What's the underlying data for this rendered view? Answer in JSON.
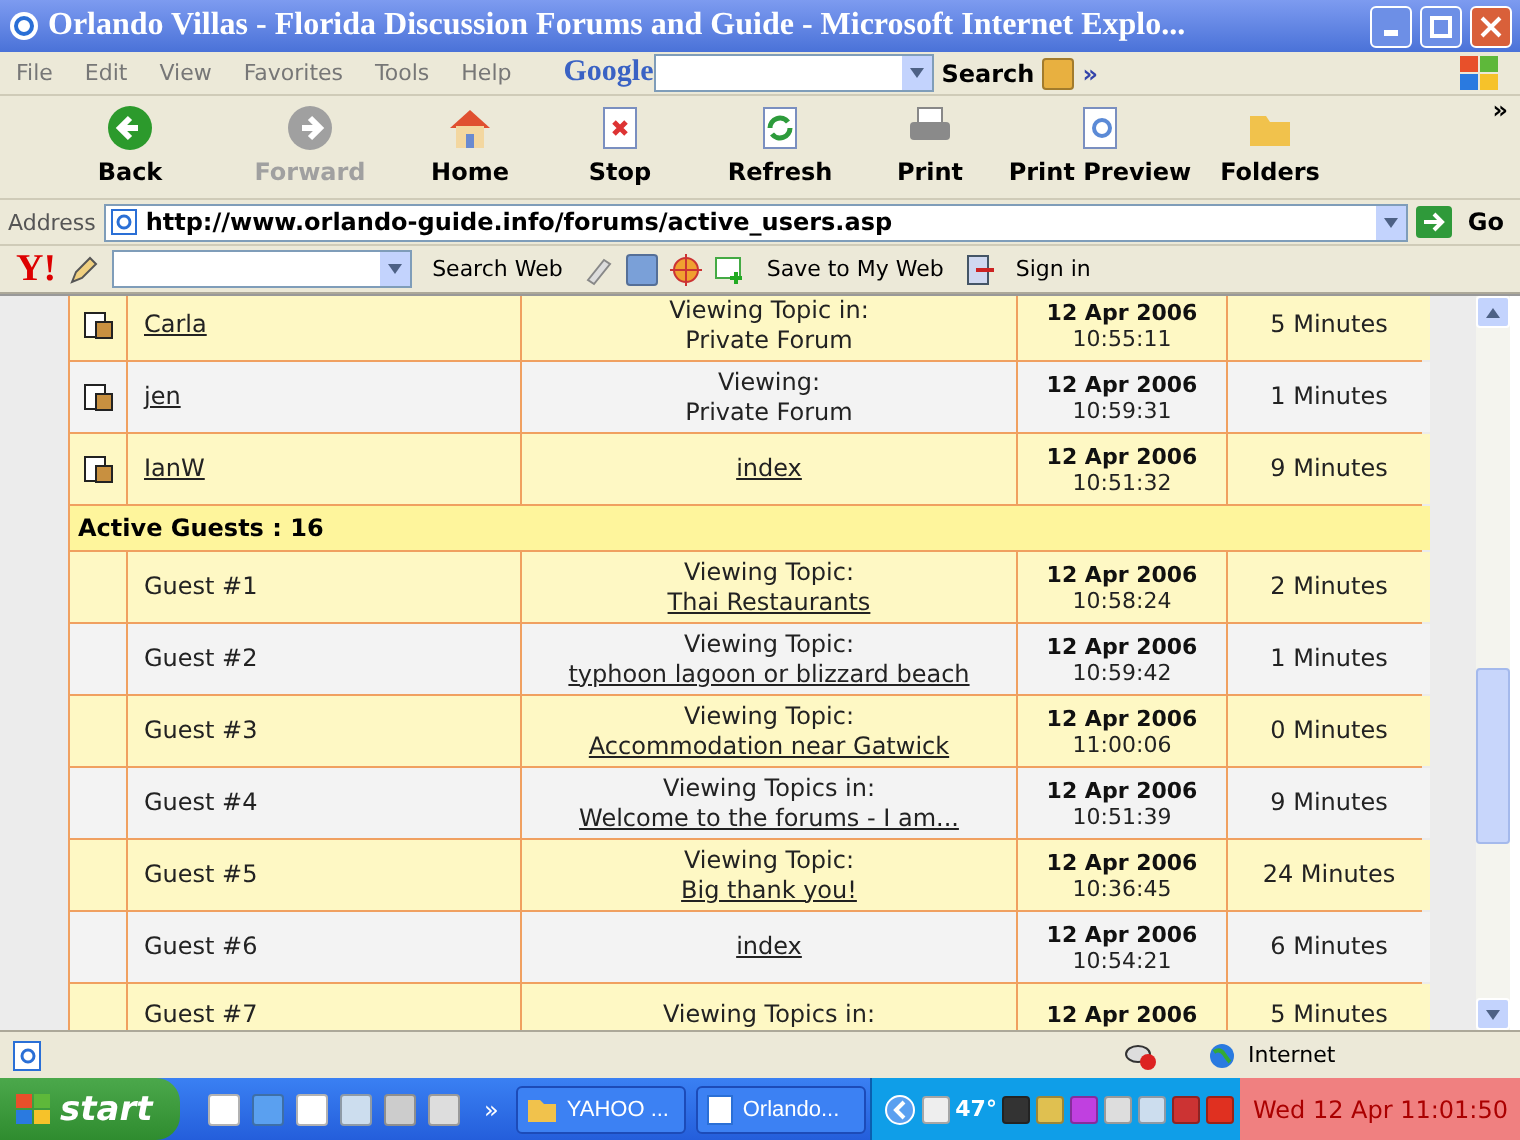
{
  "window": {
    "title": "Orlando Villas - Florida Discussion Forums and Guide - Microsoft Internet Explo..."
  },
  "menu": [
    "File",
    "Edit",
    "View",
    "Favorites",
    "Tools",
    "Help"
  ],
  "google": {
    "logo": "Google",
    "search": "Search",
    "more": "»"
  },
  "toolbar": [
    {
      "kind": "back",
      "label": "Back",
      "disabled": false
    },
    {
      "kind": "forward",
      "label": "Forward",
      "disabled": true
    },
    {
      "kind": "home",
      "label": "Home",
      "disabled": false
    },
    {
      "kind": "stop",
      "label": "Stop",
      "disabled": false
    },
    {
      "kind": "refresh",
      "label": "Refresh",
      "disabled": false
    },
    {
      "kind": "print",
      "label": "Print",
      "disabled": false
    },
    {
      "kind": "preview",
      "label": "Print Preview",
      "disabled": false
    },
    {
      "kind": "folders",
      "label": "Folders",
      "disabled": false
    }
  ],
  "toolbar_more": "»",
  "address": {
    "label": "Address",
    "url": "http://www.orlando-guide.info/forums/active_users.asp",
    "go": "Go"
  },
  "yahoo": {
    "logo": "Y!",
    "search": "Search Web",
    "save": "Save to My Web",
    "signin": "Sign in"
  },
  "rows": [
    {
      "kind": "member",
      "name": "Carla",
      "location": [
        {
          "text": "Viewing Topic in:",
          "linked": false
        },
        {
          "text": "Private Forum",
          "linked": false
        }
      ],
      "date": "12 Apr 2006",
      "time": "10:55:11",
      "duration": "5 Minutes"
    },
    {
      "kind": "member",
      "name": "jen",
      "location": [
        {
          "text": "Viewing:",
          "linked": false
        },
        {
          "text": "Private Forum",
          "linked": false
        }
      ],
      "date": "12 Apr 2006",
      "time": "10:59:31",
      "duration": "1 Minutes"
    },
    {
      "kind": "member",
      "name": "IanW",
      "location": [
        {
          "text": "index",
          "linked": true
        }
      ],
      "date": "12 Apr 2006",
      "time": "10:51:32",
      "duration": "9 Minutes"
    },
    {
      "kind": "header",
      "text": "Active Guests : 16"
    },
    {
      "kind": "guest",
      "name": "Guest #1",
      "location": [
        {
          "text": "Viewing Topic:",
          "linked": false
        },
        {
          "text": "Thai Restaurants",
          "linked": true
        }
      ],
      "date": "12 Apr 2006",
      "time": "10:58:24",
      "duration": "2 Minutes"
    },
    {
      "kind": "guest",
      "name": "Guest #2",
      "location": [
        {
          "text": "Viewing Topic:",
          "linked": false
        },
        {
          "text": "typhoon lagoon or blizzard beach",
          "linked": true
        }
      ],
      "date": "12 Apr 2006",
      "time": "10:59:42",
      "duration": "1 Minutes"
    },
    {
      "kind": "guest",
      "name": "Guest #3",
      "location": [
        {
          "text": "Viewing Topic:",
          "linked": false
        },
        {
          "text": "Accommodation near Gatwick",
          "linked": true
        }
      ],
      "date": "12 Apr 2006",
      "time": "11:00:06",
      "duration": "0 Minutes"
    },
    {
      "kind": "guest",
      "name": "Guest #4",
      "location": [
        {
          "text": "Viewing Topics in:",
          "linked": false
        },
        {
          "text": "Welcome to the forums - I am...",
          "linked": true
        }
      ],
      "date": "12 Apr 2006",
      "time": "10:51:39",
      "duration": "9 Minutes"
    },
    {
      "kind": "guest",
      "name": "Guest #5",
      "location": [
        {
          "text": "Viewing Topic:",
          "linked": false
        },
        {
          "text": "Big thank you!",
          "linked": true
        }
      ],
      "date": "12 Apr 2006",
      "time": "10:36:45",
      "duration": "24 Minutes"
    },
    {
      "kind": "guest",
      "name": "Guest #6",
      "location": [
        {
          "text": "index",
          "linked": true
        }
      ],
      "date": "12 Apr 2006",
      "time": "10:54:21",
      "duration": "6 Minutes"
    },
    {
      "kind": "guest",
      "name": "Guest #7",
      "location": [
        {
          "text": "Viewing Topics in:",
          "linked": false
        }
      ],
      "date": "12 Apr 2006",
      "duration": "5 Minutes"
    }
  ],
  "status_bar": {
    "zone": "Internet"
  },
  "taskbar": {
    "start": "start",
    "more": "»",
    "tasks": [
      {
        "label": "YAHOO ...",
        "kind": "folder",
        "selected": false
      },
      {
        "label": "Orlando...",
        "kind": "browser",
        "selected": false
      }
    ],
    "temperature": "47°",
    "clock": "Wed 12 Apr  11:01:50"
  }
}
